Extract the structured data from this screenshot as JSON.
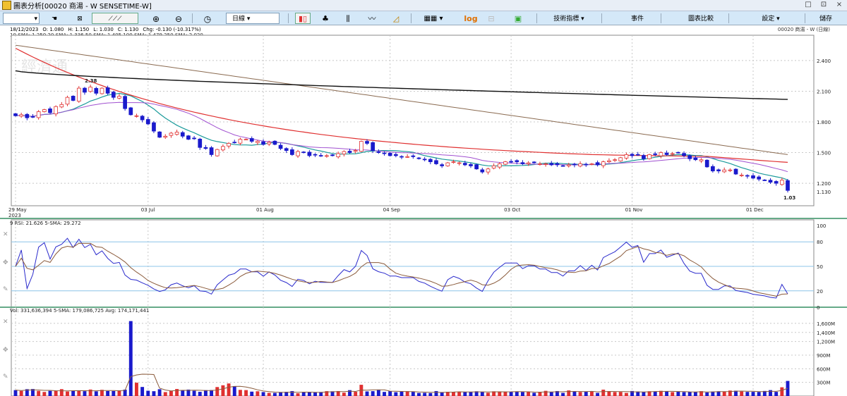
{
  "window": {
    "title": "圖表分析[00020 商湯 - W SENSETIME-W]",
    "controls": [
      "□",
      "⊡",
      "×"
    ]
  },
  "toolbar": {
    "period_select": "日線",
    "tech_menu": "技術指標",
    "events": "事件",
    "compare": "圖表比較",
    "settings": "設定",
    "save": "儲存",
    "log": "log"
  },
  "quote": {
    "date": "18/12/2023",
    "open": "O: 1.080",
    "high": "H: 1.150",
    "low": "L: 1.030",
    "close": "C: 1.130",
    "change": "Chg: -0.130 (-10.317%)"
  },
  "sma_legend": "10-SMA: 1.250 20-SMA: 1.336 50-SMA: 1.405 100-SMA: 1.479 250-SMA: 2.020",
  "stock_legend": "00020 商湯 - W (日線)",
  "watermark": "經濟通",
  "price_axis": {
    "ticks": [
      "2.400",
      "2.100",
      "1.800",
      "1.500",
      "1.200"
    ],
    "last": "1.130",
    "high_label": "2.38",
    "low_label": "1.03"
  },
  "date_axis": {
    "labels": [
      "29 May",
      "03 Jul",
      "01 Aug",
      "04 Sep",
      "03 Oct",
      "01 Nov",
      "01 Dec"
    ],
    "year": "2023"
  },
  "rsi": {
    "legend": "9 RSI: 21.626 5-SMA: 29.272",
    "ticks": [
      "100",
      "80",
      "50",
      "20",
      "0"
    ]
  },
  "volume": {
    "legend": "Vol: 331,636,394 5-SMA: 179,086,725 Avg: 174,171,441",
    "ticks": [
      "1,600M",
      "1,400M",
      "1,200M",
      "900M",
      "600M",
      "300M"
    ]
  },
  "colors": {
    "up": "#e03030",
    "down": "#1a1acc",
    "sma10": "#1a9a9a",
    "sma20": "#a050d0",
    "sma50": "#e03030",
    "sma100": "#8a6a50",
    "sma250": "#111111",
    "rsi": "#2a2acc",
    "rsi_sma": "#8a5a3a",
    "vol_sma": "#8a5a3a",
    "grid": "#c8c8c8",
    "toolbar": "#d4e8f8"
  },
  "chart_data": {
    "type": "candlestick",
    "notes_scale": {
      "price_ylim": [
        0.98,
        2.62
      ],
      "rsi_ylim": [
        0,
        100
      ],
      "volume_ylim": [
        0,
        1800000000
      ]
    },
    "close": [
      1.86,
      1.87,
      1.84,
      1.85,
      1.9,
      1.92,
      1.89,
      1.95,
      1.97,
      2.04,
      2.01,
      2.13,
      2.09,
      2.14,
      2.08,
      2.13,
      2.08,
      2.04,
      2.05,
      1.93,
      1.87,
      1.86,
      1.82,
      1.78,
      1.71,
      1.65,
      1.66,
      1.69,
      1.7,
      1.66,
      1.63,
      1.64,
      1.55,
      1.54,
      1.48,
      1.53,
      1.56,
      1.59,
      1.6,
      1.63,
      1.63,
      1.61,
      1.61,
      1.58,
      1.6,
      1.58,
      1.54,
      1.52,
      1.48,
      1.51,
      1.5,
      1.47,
      1.48,
      1.47,
      1.47,
      1.47,
      1.49,
      1.51,
      1.5,
      1.52,
      1.61,
      1.59,
      1.52,
      1.5,
      1.49,
      1.47,
      1.47,
      1.46,
      1.46,
      1.46,
      1.44,
      1.43,
      1.41,
      1.39,
      1.37,
      1.4,
      1.41,
      1.4,
      1.38,
      1.37,
      1.34,
      1.31,
      1.34,
      1.37,
      1.39,
      1.41,
      1.41,
      1.41,
      1.39,
      1.4,
      1.4,
      1.39,
      1.39,
      1.38,
      1.38,
      1.37,
      1.38,
      1.38,
      1.39,
      1.38,
      1.39,
      1.38,
      1.41,
      1.42,
      1.43,
      1.45,
      1.48,
      1.47,
      1.48,
      1.44,
      1.48,
      1.48,
      1.5,
      1.48,
      1.49,
      1.5,
      1.47,
      1.44,
      1.43,
      1.43,
      1.36,
      1.32,
      1.32,
      1.33,
      1.33,
      1.29,
      1.28,
      1.27,
      1.25,
      1.24,
      1.23,
      1.21,
      1.2,
      1.23,
      1.13
    ],
    "volume": [
      130,
      113,
      150,
      154,
      113,
      89,
      113,
      112,
      151,
      99,
      109,
      115,
      106,
      142,
      103,
      136,
      110,
      109,
      124,
      140,
      1650,
      293,
      199,
      116,
      106,
      149,
      86,
      111,
      154,
      125,
      141,
      115,
      92,
      128,
      131,
      197,
      236,
      276,
      218,
      135,
      130,
      96,
      104,
      86,
      69,
      68,
      85,
      93,
      108,
      60,
      78,
      87,
      82,
      88,
      107,
      104,
      109,
      74,
      129,
      92,
      247,
      101,
      107,
      131,
      90,
      107,
      84,
      94,
      106,
      92,
      67,
      70,
      65,
      109,
      82,
      93,
      89,
      90,
      87,
      88,
      104,
      88,
      72,
      103,
      101,
      96,
      91,
      95,
      88,
      92,
      71,
      84,
      114,
      87,
      109,
      68,
      123,
      106,
      88,
      95,
      97,
      68,
      140,
      105,
      87,
      89,
      68,
      110,
      100,
      86,
      105,
      97,
      114,
      107,
      86,
      93,
      86,
      86,
      91,
      107,
      78,
      98,
      104,
      100,
      120,
      117,
      99,
      90,
      91,
      89,
      111,
      130,
      91,
      192,
      332
    ]
  }
}
